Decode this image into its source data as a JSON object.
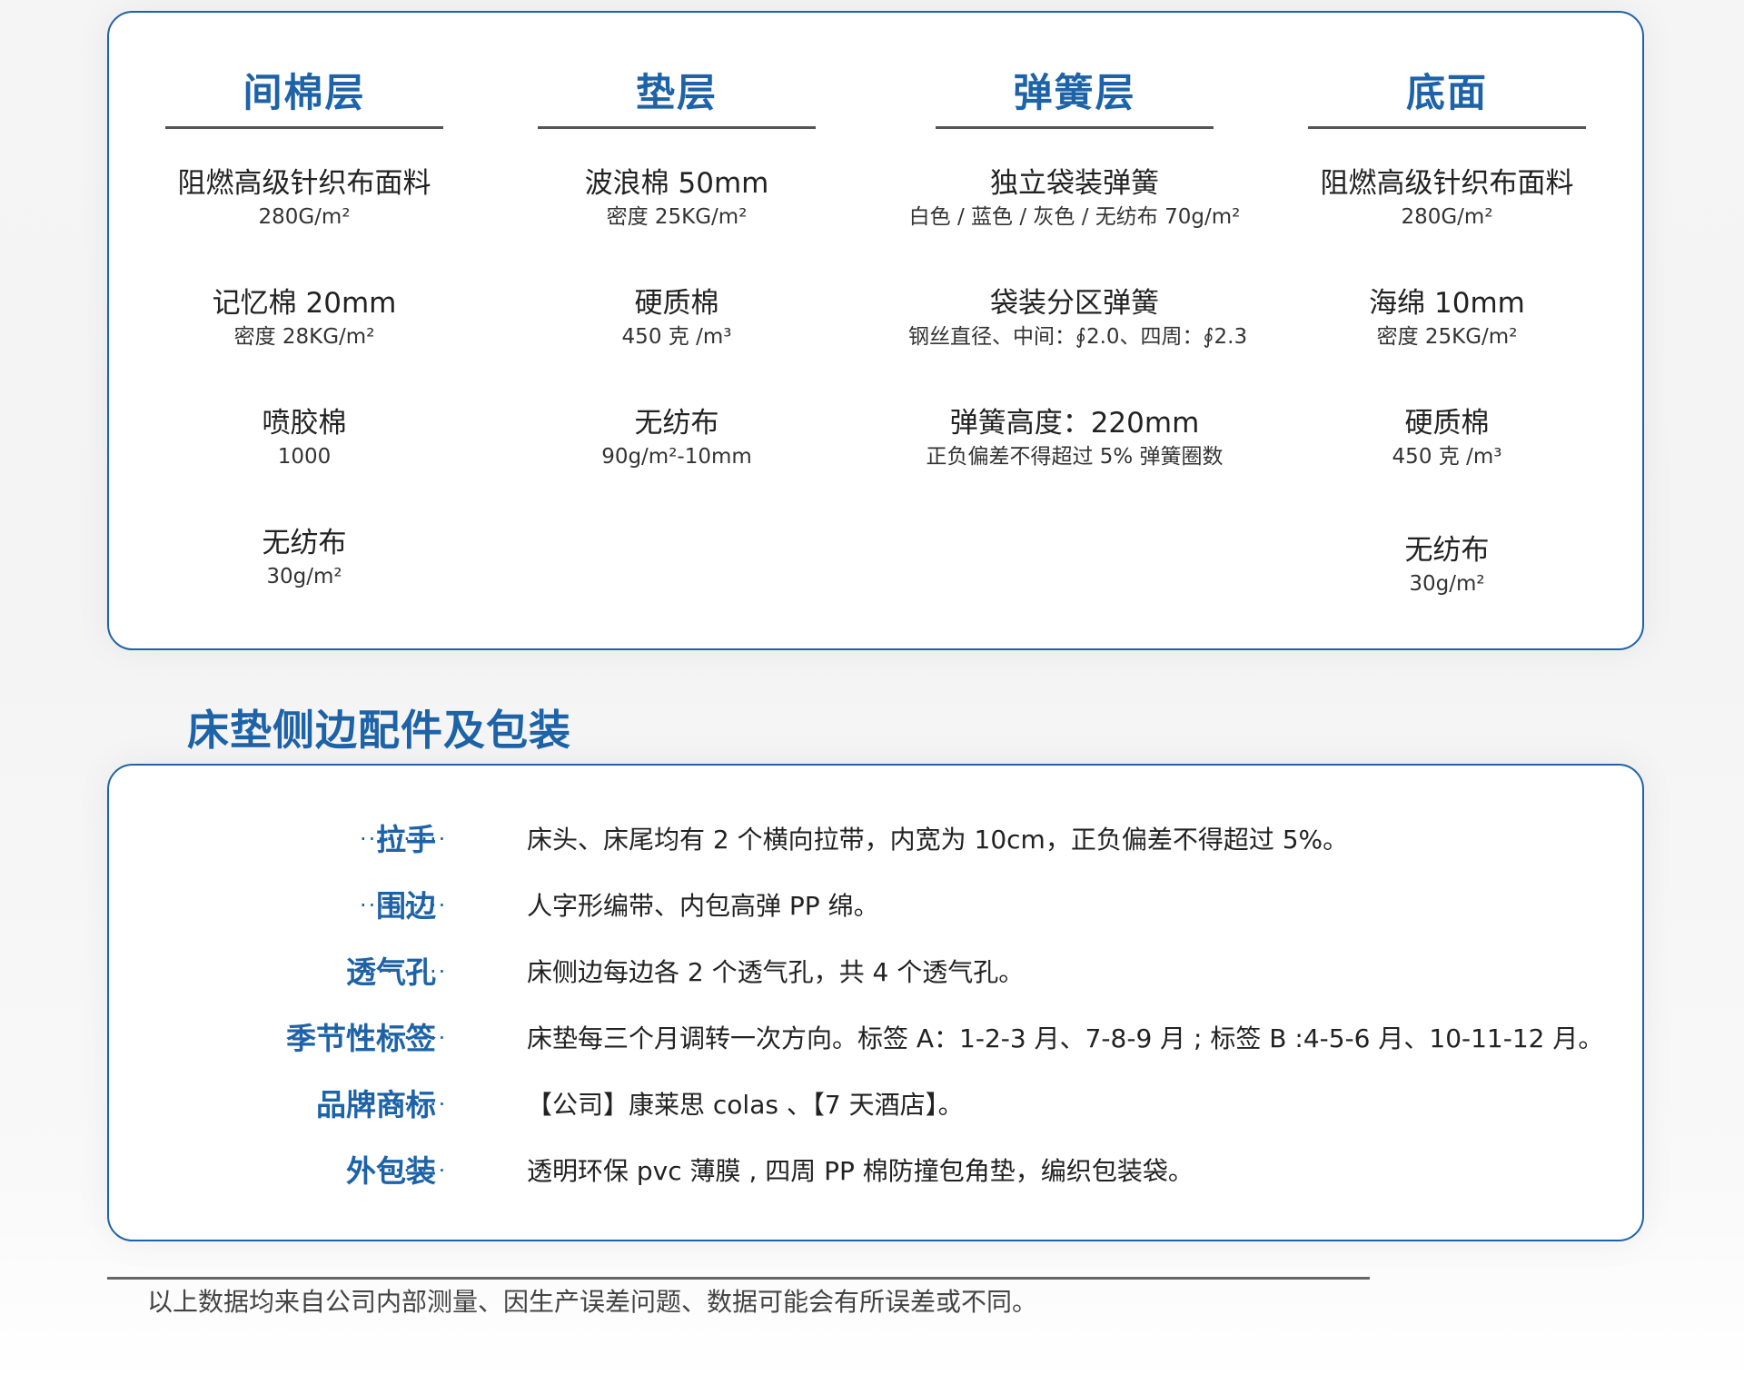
{
  "layers": [
    {
      "title": "间棉层",
      "items": [
        {
          "name": "阻燃高级针织布面料",
          "spec": "280G/m²"
        },
        {
          "name": "记忆棉 20mm",
          "spec": "密度 28KG/m²"
        },
        {
          "name": "喷胶棉",
          "spec": "1000"
        },
        {
          "name": "无纺布",
          "spec": "30g/m²"
        }
      ]
    },
    {
      "title": "垫层",
      "items": [
        {
          "name": "波浪棉 50mm",
          "spec": "密度 25KG/m²"
        },
        {
          "name": "硬质棉",
          "spec": "450 克 /m³"
        },
        {
          "name": "无纺布",
          "spec": "90g/m²-10mm"
        }
      ]
    },
    {
      "title": "弹簧层",
      "items": [
        {
          "name": "独立袋装弹簧",
          "spec": "白色 / 蓝色 / 灰色 / 无纺布 70g/m²"
        },
        {
          "name": "袋装分区弹簧",
          "spec": "钢丝直径、中间：∮2.0、四周：∮2.3"
        },
        {
          "name": "弹簧高度：220mm",
          "spec": "正负偏差不得超过 5% 弹簧圈数"
        }
      ]
    },
    {
      "title": "底面",
      "items": [
        {
          "name": "阻燃高级针织布面料",
          "spec": "280G/m²"
        },
        {
          "name": "海绵 10mm",
          "spec": "密度 25KG/m²"
        },
        {
          "name": "硬质棉",
          "spec": "450 克 /m³"
        },
        {
          "name": "无纺布",
          "spec": "30g/m²"
        }
      ]
    }
  ],
  "accessories": {
    "title": "床垫侧边配件及包装",
    "dots": "··········",
    "rows": [
      {
        "label": "拉手",
        "value": "床头、床尾均有 2 个横向拉带，内宽为 10cm，正负偏差不得超过 5%。"
      },
      {
        "label": "围边",
        "value": "人字形编带、内包高弹 PP 绵。"
      },
      {
        "label": "透气孔",
        "value": "床侧边每边各 2 个透气孔，共 4 个透气孔。"
      },
      {
        "label": "季节性标签",
        "value": "床垫每三个月调转一次方向。标签 A：1-2-3 月、7-8-9 月 ; 标签 B :4-5-6 月、10-11-12 月。"
      },
      {
        "label": "品牌商标",
        "value": "【公司】康莱思 colas 、【7 天酒店】。"
      },
      {
        "label": "外包装",
        "value": "透明环保 pvc 薄膜 , 四周 PP 棉防撞包角垫，编织包装袋。"
      }
    ]
  },
  "footer": {
    "note": "以上数据均来自公司内部测量、因生产误差问题、数据可能会有所误差或不同。"
  }
}
